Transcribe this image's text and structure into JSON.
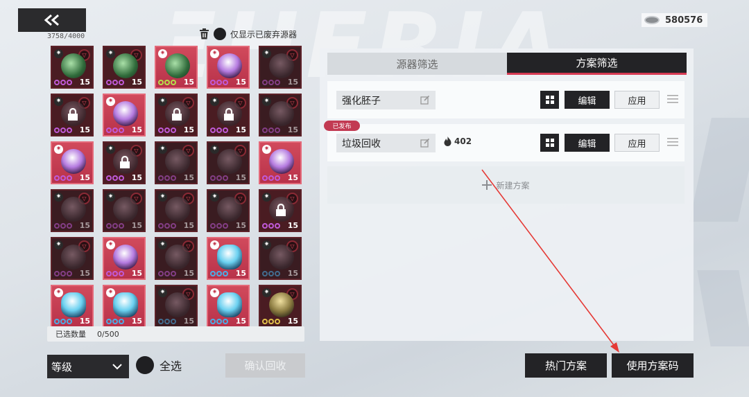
{
  "topbar": {
    "capacity": "3758/4000",
    "discard_filter_label": "仅显示已废弃源器",
    "currency_value": "580576"
  },
  "grid": {
    "cells": [
      {
        "art": "green",
        "dots": "purple",
        "level": "15",
        "hl": false,
        "dim": false,
        "locked": false
      },
      {
        "art": "green",
        "dots": "purple",
        "level": "15",
        "hl": false,
        "dim": false,
        "locked": false
      },
      {
        "art": "green",
        "dots": "green",
        "level": "15",
        "hl": true,
        "dim": false,
        "locked": false
      },
      {
        "art": "purple",
        "dots": "purple",
        "level": "15",
        "hl": true,
        "dim": false,
        "locked": false
      },
      {
        "art": "dark",
        "dots": "purple",
        "level": "15",
        "hl": false,
        "dim": true,
        "locked": false
      },
      {
        "art": "dark",
        "dots": "purple",
        "level": "15",
        "hl": false,
        "dim": false,
        "locked": true
      },
      {
        "art": "purple",
        "dots": "purple",
        "level": "15",
        "hl": true,
        "dim": false,
        "locked": false
      },
      {
        "art": "dark",
        "dots": "purple",
        "level": "15",
        "hl": false,
        "dim": false,
        "locked": true
      },
      {
        "art": "dark",
        "dots": "purple",
        "level": "15",
        "hl": false,
        "dim": false,
        "locked": true
      },
      {
        "art": "dark",
        "dots": "purple",
        "level": "15",
        "hl": false,
        "dim": true,
        "locked": false
      },
      {
        "art": "purple",
        "dots": "purple",
        "level": "15",
        "hl": true,
        "dim": false,
        "locked": false
      },
      {
        "art": "dark",
        "dots": "purple",
        "level": "15",
        "hl": false,
        "dim": false,
        "locked": true
      },
      {
        "art": "dark",
        "dots": "purple",
        "level": "15",
        "hl": false,
        "dim": true,
        "locked": false
      },
      {
        "art": "dark",
        "dots": "purple",
        "level": "15",
        "hl": false,
        "dim": true,
        "locked": false
      },
      {
        "art": "purple",
        "dots": "purple",
        "level": "15",
        "hl": true,
        "dim": false,
        "locked": false
      },
      {
        "art": "dark",
        "dots": "purple",
        "level": "15",
        "hl": false,
        "dim": true,
        "locked": false
      },
      {
        "art": "dark",
        "dots": "purple",
        "level": "15",
        "hl": false,
        "dim": true,
        "locked": false
      },
      {
        "art": "dark",
        "dots": "purple",
        "level": "15",
        "hl": false,
        "dim": true,
        "locked": false
      },
      {
        "art": "dark",
        "dots": "purple",
        "level": "15",
        "hl": false,
        "dim": true,
        "locked": false
      },
      {
        "art": "dark",
        "dots": "purple",
        "level": "15",
        "hl": false,
        "dim": false,
        "locked": true
      },
      {
        "art": "dark",
        "dots": "purple",
        "level": "15",
        "hl": false,
        "dim": true,
        "locked": false
      },
      {
        "art": "purple",
        "dots": "purple",
        "level": "15",
        "hl": true,
        "dim": false,
        "locked": false
      },
      {
        "art": "dark",
        "dots": "purple",
        "level": "15",
        "hl": false,
        "dim": true,
        "locked": false
      },
      {
        "art": "blue",
        "dots": "blue",
        "level": "15",
        "hl": true,
        "dim": false,
        "locked": false
      },
      {
        "art": "dark",
        "dots": "blue",
        "level": "15",
        "hl": false,
        "dim": true,
        "locked": false
      },
      {
        "art": "blue",
        "dots": "blue",
        "level": "15",
        "hl": true,
        "dim": false,
        "locked": false
      },
      {
        "art": "blue",
        "dots": "blue",
        "level": "15",
        "hl": true,
        "dim": false,
        "locked": false
      },
      {
        "art": "dark",
        "dots": "blue",
        "level": "15",
        "hl": false,
        "dim": true,
        "locked": false
      },
      {
        "art": "blue",
        "dots": "blue",
        "level": "15",
        "hl": true,
        "dim": false,
        "locked": false
      },
      {
        "art": "gold",
        "dots": "gold",
        "level": "15",
        "hl": false,
        "dim": false,
        "locked": false
      }
    ],
    "selected_label": "已选数量",
    "selected_value": "0/500"
  },
  "controls": {
    "sort_value": "等级",
    "select_all_label": "全选",
    "confirm_recycle_label": "确认回收"
  },
  "panel": {
    "tabs": [
      {
        "label": "源器筛选",
        "active": false
      },
      {
        "label": "方案筛选",
        "active": true
      }
    ],
    "schemes": [
      {
        "name": "强化胚子",
        "published": false,
        "heat": "",
        "edit_label": "编辑",
        "apply_label": "应用"
      },
      {
        "name": "垃圾回收",
        "published": true,
        "heat": "402",
        "edit_label": "编辑",
        "apply_label": "应用"
      }
    ],
    "published_tag": "已发布",
    "new_scheme_label": "新建方案",
    "hot_schemes_label": "热门方案",
    "use_code_label": "使用方案码"
  },
  "colors": {
    "accent": "#d63a52",
    "dark": "#232326",
    "annotation_arrow": "#e53935"
  },
  "icons": [
    "back-icon",
    "trash-icon",
    "lock-icon",
    "edit-icon",
    "fire-icon",
    "grid-icon",
    "drag-handle-icon",
    "plus-icon",
    "coin-icon",
    "chevron-down-icon"
  ]
}
